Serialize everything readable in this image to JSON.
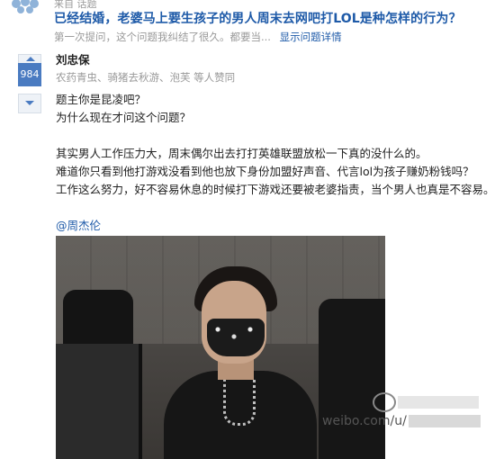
{
  "header": {
    "breadcrumb": "来自 话题",
    "title": "已经结婚，老婆马上要生孩子的男人周末去网吧打LOL是种怎样的行为？",
    "meta": "第一次提问，这个问题我纠结了很久。都要当...",
    "more_link": "显示问题详情"
  },
  "answer": {
    "vote_count": "984",
    "author": "刘忠保",
    "voters": "农药青虫、骑猪去秋游、泡芙 等人赞同",
    "lines": [
      "题主你是昆凌吧？",
      "为什么现在才问这个问题？",
      "其实男人工作压力大，周末偶尔出去打打英雄联盟放松一下真的没什么的。",
      "难道你只看到他打游戏没看到他也放下身份加盟好声音、代言lol为孩子赚奶粉钱吗？",
      "工作这么努力，好不容易休息的时候打下游戏还要被老婆指责，当个男人也真是不容易。"
    ],
    "mention": "@周杰伦"
  },
  "watermark": {
    "text": "weibo.com/u/"
  },
  "colors": {
    "link": "#1e5aa8",
    "vote_bg": "#4a7bc1",
    "muted": "#999999"
  },
  "icons": [
    "site-logo-icon",
    "upvote-arrow-icon",
    "downvote-arrow-icon",
    "weibo-icon"
  ]
}
